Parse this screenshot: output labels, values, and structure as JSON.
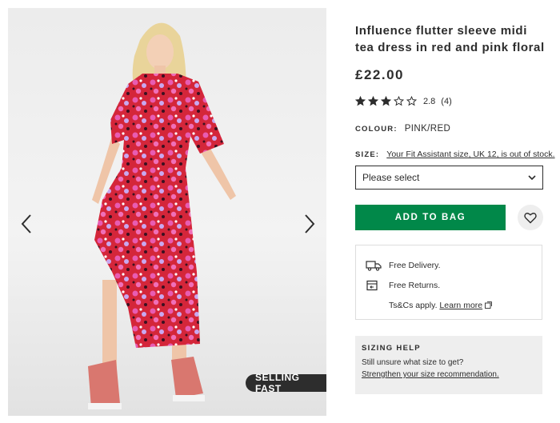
{
  "gallery": {
    "badge": "SELLING FAST"
  },
  "product": {
    "title": "Influence flutter sleeve midi tea dress in red and pink floral",
    "price": "£22.00",
    "rating": {
      "stars": 2.8,
      "score": "2.8",
      "count": "(4)"
    },
    "colour_label": "COLOUR:",
    "colour_value": "PINK/RED",
    "size_label": "SIZE:",
    "size_notice": "Your Fit Assistant size, UK 12, is out of stock.",
    "size_placeholder": "Please select",
    "add_to_bag": "ADD TO BAG"
  },
  "delivery": {
    "free_delivery": "Free Delivery.",
    "free_returns": "Free Returns.",
    "terms": "Ts&Cs apply.",
    "learn_more": "Learn more"
  },
  "sizing_help": {
    "heading": "SIZING HELP",
    "text": "Still unsure what size to get?",
    "link": "Strengthen your size recommendation."
  },
  "colors": {
    "add_button": "#018849",
    "text": "#2d2d2d",
    "dress_red": "#d4263a",
    "dress_pink": "#e85cb2"
  },
  "icons": [
    "chevron-left-icon",
    "chevron-right-icon",
    "star-icon",
    "chevron-down-icon",
    "heart-icon",
    "truck-icon",
    "returns-icon",
    "external-link-icon"
  ]
}
